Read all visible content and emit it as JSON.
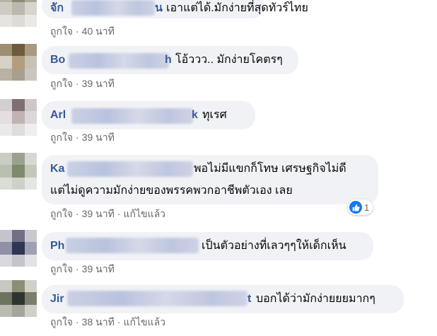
{
  "colors": {
    "author": "#385898",
    "meta": "#65676b",
    "bubble": "#f0f2f5",
    "like_badge": "#1877f2"
  },
  "comments": [
    {
      "author_start": "จัก",
      "author_end": "น",
      "text": "เอาแต่ได้.มักง่ายที่สุดทัวร์ไทย",
      "like_label": "ถูกใจ",
      "time": "40 นาที"
    },
    {
      "author_start": "Bo",
      "author_end": "h",
      "text": "โอ้ววว.. มักง่ายโคตรๆ",
      "like_label": "ถูกใจ",
      "time": "39 นาที"
    },
    {
      "author_start": "Arl",
      "author_end": "k",
      "text": "ทุเรศ",
      "like_label": "ถูกใจ",
      "time": "39 นาที"
    },
    {
      "author_start": "Ka",
      "text_line1": "พอไม่มีแขกก็โทษ เศรษฐกิจไม่ดี",
      "text_line2": "แต่ไม่ดูความมักง่ายของพรรคพวกอาชีพตัวเอง เลย",
      "like_label": "ถูกใจ",
      "time": "39 นาที",
      "edited": "แก้ไขแล้ว",
      "reaction_count": "1"
    },
    {
      "author_start": "Ph",
      "text": "เป็นตัวอย่างที่เลวๆๆให้เด็กเห็น",
      "like_label": "ถูกใจ",
      "time": "39 นาที"
    },
    {
      "author_start": "Jir",
      "author_end": "t",
      "text": "บอกได้ว่ามักง่ายยยมากๆ",
      "like_label": "ถูกใจ",
      "time": "38 นาที",
      "edited": "แก้ไขแล้ว"
    }
  ],
  "icons": {
    "reaction": "thumbs-up-icon",
    "avatar": "pixelated-avatar"
  }
}
